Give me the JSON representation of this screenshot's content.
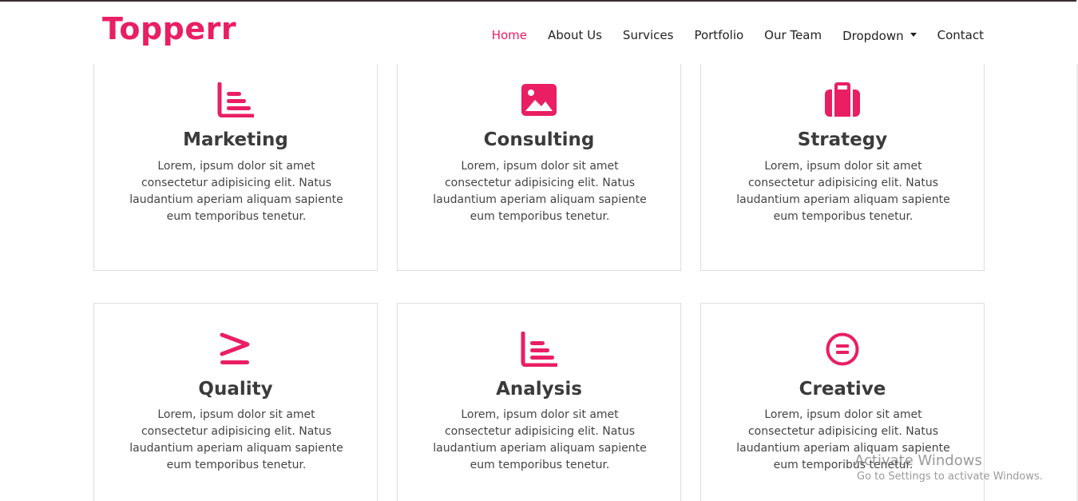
{
  "brand": {
    "logo": "Topperr",
    "accent": "#e91e63"
  },
  "nav": {
    "items": [
      {
        "label": "Home",
        "active": true
      },
      {
        "label": "About Us"
      },
      {
        "label": "Survices"
      },
      {
        "label": "Portfolio"
      },
      {
        "label": "Our Team"
      },
      {
        "label": "Dropdown",
        "has_caret": true
      },
      {
        "label": "Contact"
      }
    ]
  },
  "services": [
    {
      "icon": "bar-list-icon",
      "title": "Marketing",
      "text": "Lorem, ipsum dolor sit amet consectetur adipisicing elit. Natus laudantium aperiam aliquam sapiente eum temporibus tenetur."
    },
    {
      "icon": "image-icon",
      "title": "Consulting",
      "text": "Lorem, ipsum dolor sit amet consectetur adipisicing elit. Natus laudantium aperiam aliquam sapiente eum temporibus tenetur."
    },
    {
      "icon": "briefcase-icon",
      "title": "Strategy",
      "text": "Lorem, ipsum dolor sit amet consectetur adipisicing elit. Natus laudantium aperiam aliquam sapiente eum temporibus tenetur."
    },
    {
      "icon": "greater-equal-icon",
      "title": "Quality",
      "text": "Lorem, ipsum dolor sit amet consectetur adipisicing elit. Natus laudantium aperiam aliquam sapiente eum temporibus tenetur."
    },
    {
      "icon": "bar-list-icon",
      "title": "Analysis",
      "text": "Lorem, ipsum dolor sit amet consectetur adipisicing elit. Natus laudantium aperiam aliquam sapiente eum temporibus tenetur."
    },
    {
      "icon": "equals-circle-icon",
      "title": "Creative",
      "text": "Lorem, ipsum dolor sit amet consectetur adipisicing elit. Natus laudantium aperiam aliquam sapiente eum temporibus tenetur."
    }
  ],
  "watermark": {
    "line1": "Activate Windows",
    "line2": "Go to Settings to activate Windows."
  }
}
